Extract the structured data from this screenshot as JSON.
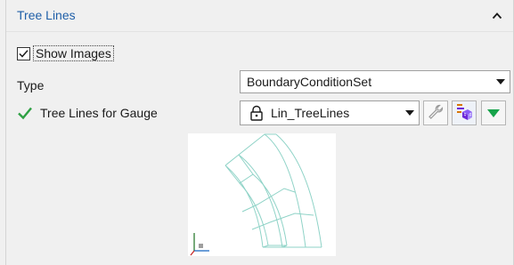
{
  "section": {
    "title": "Tree Lines",
    "collapse_icon": "chevron-up-icon"
  },
  "show_images": {
    "label": "Show Images",
    "checked": true
  },
  "type": {
    "label": "Type",
    "value": "BoundaryConditionSet"
  },
  "gauge": {
    "label": "Tree Lines for Gauge",
    "status_icon": "green-check-icon",
    "value": "Lin_TreeLines",
    "lock_icon": "lock-icon",
    "buttons": [
      "wrench-icon",
      "grid-attribute-icon",
      "green-down-arrow-icon"
    ]
  },
  "colors": {
    "header_text": "#1f5fa8",
    "check_green": "#2ea043",
    "preview_lines": "#8fd3c7",
    "arrow_green": "#16a34a"
  }
}
